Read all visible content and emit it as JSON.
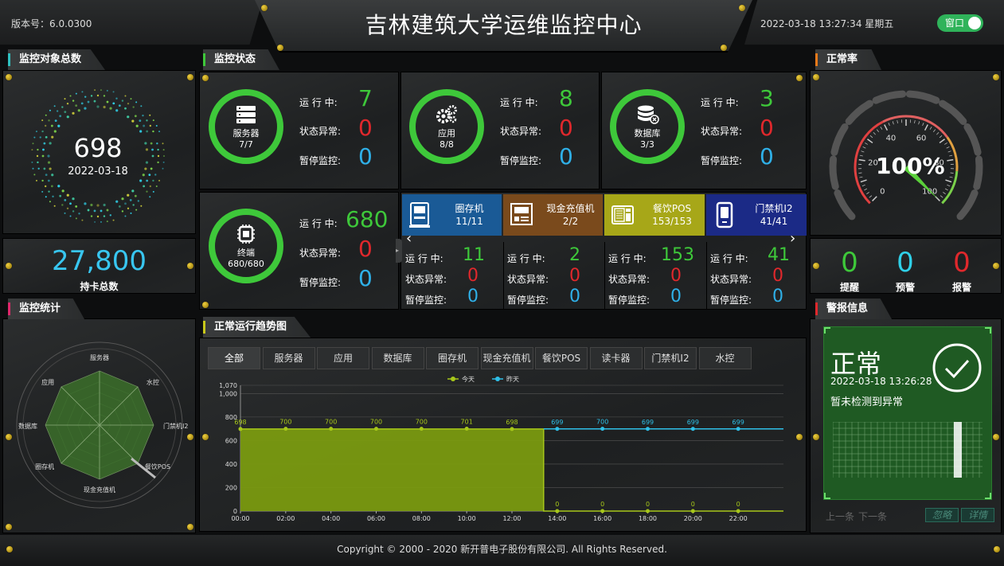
{
  "header": {
    "version_label": "版本号：6.0.0300",
    "title": "吉林建筑大学运维监控中心",
    "datetime": "2022-03-18 13:27:34 星期五",
    "window_toggle": "窗口"
  },
  "monitor_objects": {
    "title": "监控对象总数",
    "count": "698",
    "date": "2022-03-18",
    "card_total": "27,800",
    "card_total_label": "持卡总数"
  },
  "monitor_status": {
    "title": "监控状态",
    "labels": {
      "running": "运 行 中:",
      "abnormal": "状态异常:",
      "paused": "暂停监控:"
    },
    "groups": [
      {
        "name": "服务器",
        "ratio": "7/7",
        "running": "7",
        "abnormal": "0",
        "paused": "0",
        "icon": "server-icon"
      },
      {
        "name": "应用",
        "ratio": "8/8",
        "running": "8",
        "abnormal": "0",
        "paused": "0",
        "icon": "gears-icon"
      },
      {
        "name": "数据库",
        "ratio": "3/3",
        "running": "3",
        "abnormal": "0",
        "paused": "0",
        "icon": "database-icon"
      },
      {
        "name": "终端",
        "ratio": "680/680",
        "running": "680",
        "abnormal": "0",
        "paused": "0",
        "icon": "chip-icon"
      }
    ],
    "devices": [
      {
        "name": "圈存机",
        "ratio": "11/11",
        "running": "11",
        "abnormal": "0",
        "paused": "0",
        "color": "#1a5a96",
        "icon": "atm-icon"
      },
      {
        "name": "现金充值机",
        "ratio": "2/2",
        "running": "2",
        "abnormal": "0",
        "paused": "0",
        "color": "#7a4a1c",
        "icon": "recharge-machine-icon"
      },
      {
        "name": "餐饮POS",
        "ratio": "153/153",
        "running": "153",
        "abnormal": "0",
        "paused": "0",
        "color": "#a7a718",
        "icon": "pos-icon"
      },
      {
        "name": "门禁机I2",
        "ratio": "41/41",
        "running": "41",
        "abnormal": "0",
        "paused": "0",
        "color": "#1b2a86",
        "icon": "access-card-icon"
      }
    ]
  },
  "normal_rate": {
    "title": "正常率",
    "value": "100%",
    "ticks": [
      "0",
      "20",
      "40",
      "60",
      "80",
      "100"
    ],
    "counters": [
      {
        "label": "提醒",
        "value": "0",
        "color": "#3ec83a"
      },
      {
        "label": "预警",
        "value": "0",
        "color": "#2fd0e8"
      },
      {
        "label": "报警",
        "value": "0",
        "color": "#e0282c"
      }
    ]
  },
  "statistics": {
    "title": "监控统计",
    "axes": [
      "服务器",
      "水控",
      "门禁机I2",
      "餐饮POS",
      "现金充值机",
      "圈存机",
      "数据库",
      "应用"
    ]
  },
  "trend": {
    "title": "正常运行趋势图",
    "tabs": [
      "全部",
      "服务器",
      "应用",
      "数据库",
      "圈存机",
      "现金充值机",
      "餐饮POS",
      "读卡器",
      "门禁机I2",
      "水控"
    ]
  },
  "alarm": {
    "title": "警报信息",
    "status": "正常",
    "time": "2022-03-18 13:26:28",
    "message": "暂未检测到异常",
    "prev": "上一条",
    "next": "下一条",
    "ignore": "忽略",
    "detail": "详情"
  },
  "footer": {
    "copyright": "Copyright © 2000 - 2020 新开普电子股份有限公司. All Rights Reserved."
  },
  "chart_data": {
    "type": "area",
    "x": [
      "00:00",
      "01:00",
      "02:00",
      "03:00",
      "04:00",
      "05:00",
      "06:00",
      "07:00",
      "08:00",
      "09:00",
      "10:00",
      "11:00",
      "12:00",
      "13:00",
      "14:00",
      "15:00",
      "16:00",
      "17:00",
      "18:00",
      "19:00",
      "20:00",
      "21:00",
      "22:00",
      "23:00"
    ],
    "x_tick_labels": [
      "00:00",
      "02:00",
      "04:00",
      "06:00",
      "08:00",
      "10:00",
      "12:00",
      "14:00",
      "16:00",
      "18:00",
      "20:00",
      "22:00"
    ],
    "series": [
      {
        "name": "今天",
        "color": "#a7c71a",
        "values": [
          698,
          698,
          700,
          700,
          700,
          700,
          700,
          700,
          700,
          700,
          701,
          701,
          698,
          698,
          0,
          0,
          0,
          0,
          0,
          0,
          0,
          0,
          0,
          0
        ],
        "labels": [
          "698",
          "700",
          "700",
          "700",
          "700",
          "701",
          "698",
          "0",
          "0",
          "0",
          "0",
          "0"
        ]
      },
      {
        "name": "昨天",
        "color": "#2fc0e8",
        "values": [
          699,
          699,
          699,
          699,
          699,
          699,
          699,
          699,
          699,
          699,
          699,
          699,
          699,
          699,
          699,
          699,
          700,
          700,
          699,
          699,
          699,
          699,
          699,
          699
        ],
        "labels": [
          "699",
          "700",
          "699",
          "699",
          "699"
        ]
      }
    ],
    "y_ticks": [
      "0",
      "200",
      "400",
      "600",
      "800",
      "1,000",
      "1,070"
    ],
    "ylim": [
      0,
      1070
    ]
  }
}
